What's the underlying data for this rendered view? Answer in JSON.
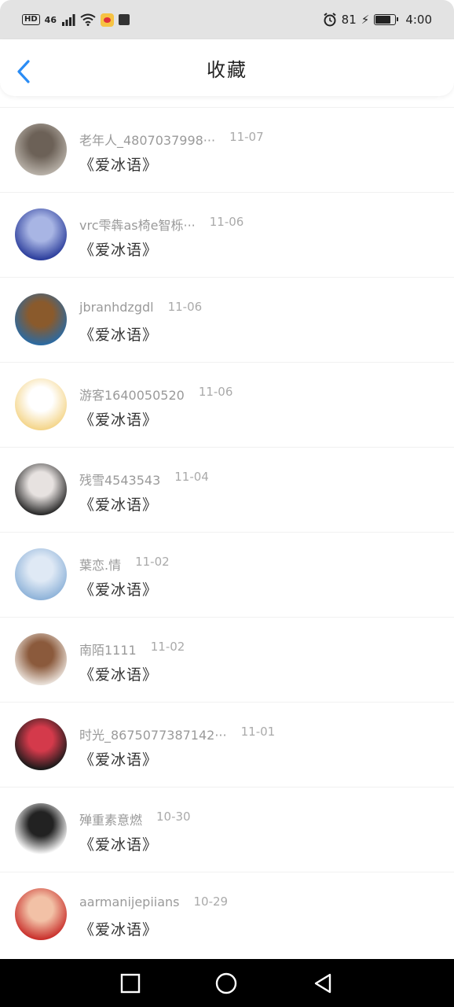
{
  "status_bar": {
    "hd": "HD",
    "signal": "46",
    "battery": "81",
    "time": "4:00"
  },
  "header": {
    "title": "收藏"
  },
  "items": [
    {
      "user": "老年人_4807037998···",
      "date": "11-07",
      "title": "《爱冰语》",
      "avatar_colors": [
        "#b7b0a7",
        "#6c6157"
      ]
    },
    {
      "user": "vrc雫犇as椅e智栎···",
      "date": "11-06",
      "title": "《爱冰语》",
      "avatar_colors": [
        "#2c3e9c",
        "#a8b5e4"
      ]
    },
    {
      "user": "jbranhdzgdl",
      "date": "11-06",
      "title": "《爱冰语》",
      "avatar_colors": [
        "#2b6aa2",
        "#8a5a2c"
      ]
    },
    {
      "user": "游客1640050520",
      "date": "11-06",
      "title": "《爱冰语》",
      "avatar_colors": [
        "#f4d58a",
        "#ffffff"
      ]
    },
    {
      "user": "残雪4543543",
      "date": "11-04",
      "title": "《爱冰语》",
      "avatar_colors": [
        "#2a2a2a",
        "#e7e2e0"
      ]
    },
    {
      "user": "葉恋.情",
      "date": "11-02",
      "title": "《爱冰语》",
      "avatar_colors": [
        "#8fb3d9",
        "#dfe9f5"
      ]
    },
    {
      "user": "南陌1111",
      "date": "11-02",
      "title": "《爱冰语》",
      "avatar_colors": [
        "#e9e0d8",
        "#8b5a3c"
      ]
    },
    {
      "user": "时光_8675077387142···",
      "date": "11-01",
      "title": "《爱冰语》",
      "avatar_colors": [
        "#1a1a1a",
        "#d43a4b"
      ]
    },
    {
      "user": "殚重素意燃",
      "date": "10-30",
      "title": "《爱冰语》",
      "avatar_colors": [
        "#ffffff",
        "#222222"
      ]
    },
    {
      "user": "aarmanijepiians",
      "date": "10-29",
      "title": "《爱冰语》",
      "avatar_colors": [
        "#c9302c",
        "#f2c1a6"
      ]
    }
  ]
}
